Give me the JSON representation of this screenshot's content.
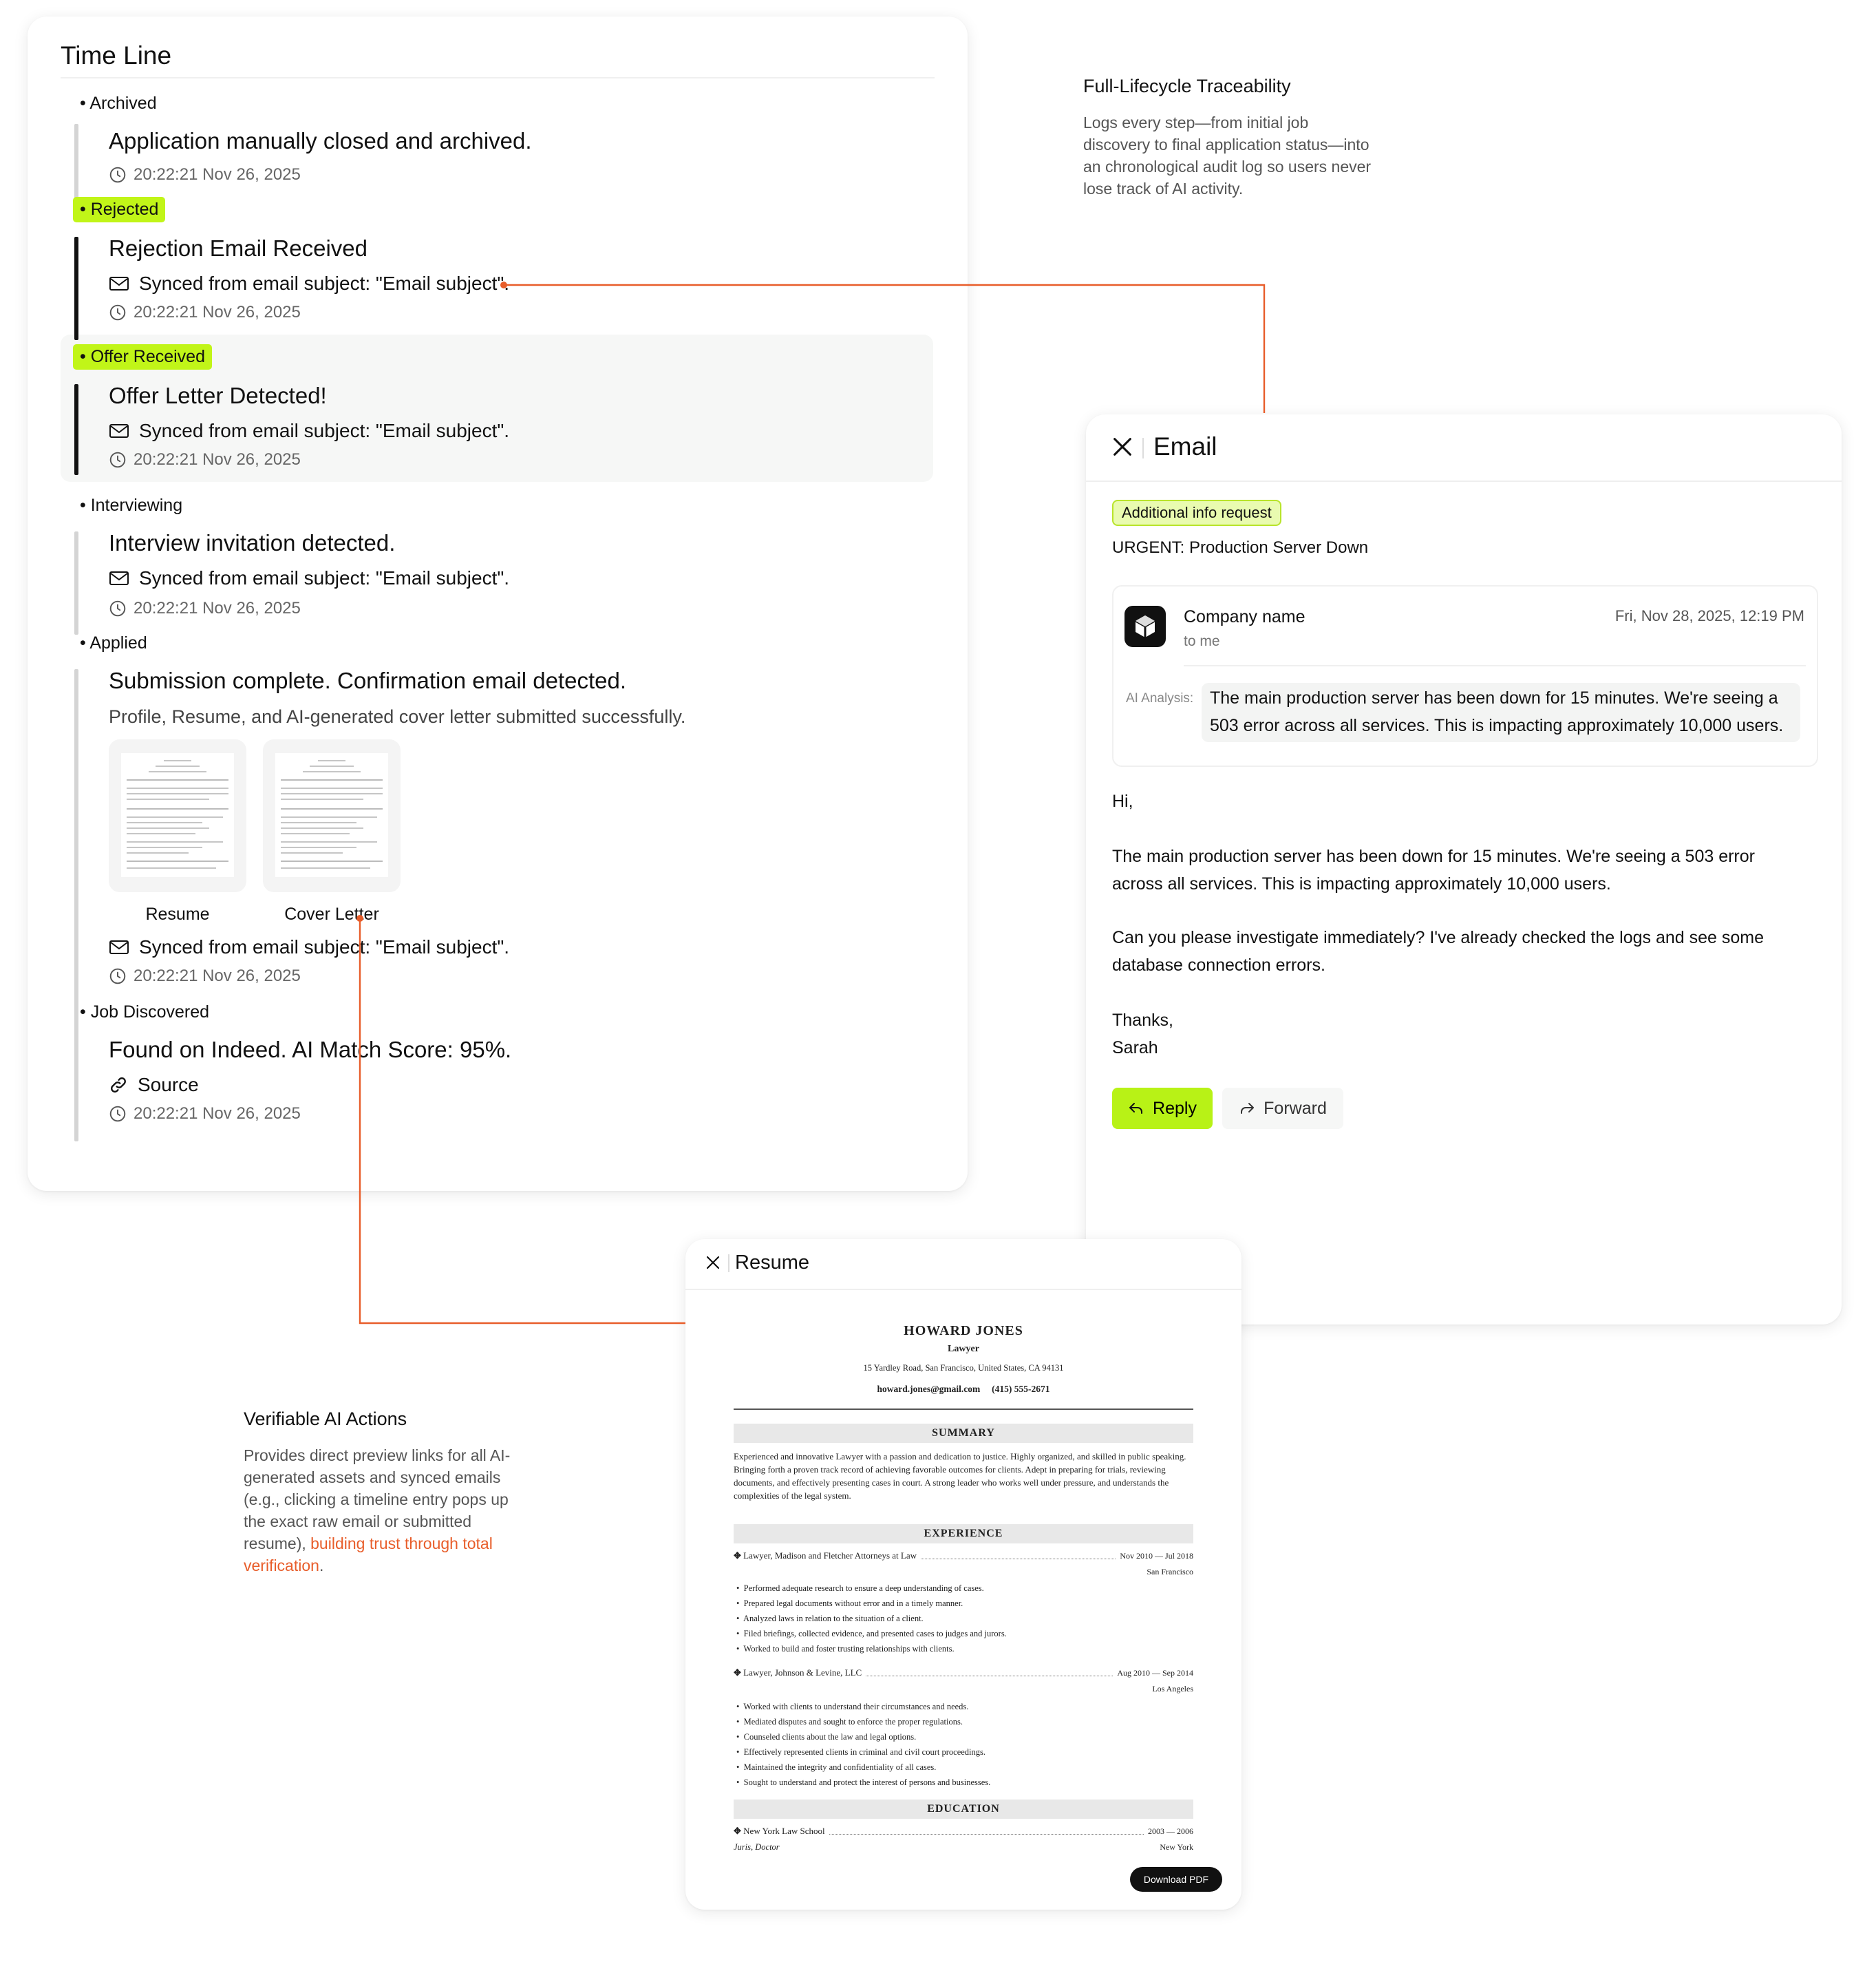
{
  "timeline": {
    "title": "Time Line",
    "entries": [
      {
        "status": "Archived",
        "title": "Application manually closed and archived.",
        "time": "20:22:21 Nov 26, 2025"
      },
      {
        "status": "Rejected",
        "title": "Rejection Email Received",
        "line": "Synced from email subject: \"Email subject\".",
        "time": "20:22:21 Nov 26, 2025"
      },
      {
        "status": "Offer Received",
        "title": "Offer Letter Detected!",
        "line": "Synced from email subject: \"Email subject\".",
        "time": "20:22:21 Nov 26, 2025"
      },
      {
        "status": "Interviewing",
        "title": "Interview invitation detected.",
        "line": "Synced from email subject: \"Email subject\".",
        "time": "20:22:21 Nov 26, 2025"
      },
      {
        "status": "Applied",
        "title": "Submission complete. Confirmation email detected.",
        "desc": "Profile, Resume, and AI-generated cover letter submitted successfully.",
        "attachments": [
          "Resume",
          "Cover Letter"
        ],
        "line": "Synced from email subject: \"Email subject\".",
        "time": "20:22:21 Nov 26, 2025"
      },
      {
        "status": "Job Discovered",
        "title": "Found on Indeed. AI Match Score: 95%.",
        "line": "Source",
        "time": "20:22:21 Nov 26, 2025"
      }
    ]
  },
  "annotations": {
    "traceability": {
      "title": "Full-Lifecycle Traceability",
      "lines": [
        "Logs every step—from initial job",
        "discovery to final application status—into",
        "an chronological audit log so users never",
        "lose track of AI activity."
      ]
    },
    "verifiable": {
      "title": "Verifiable AI Actions",
      "lines": [
        "Provides direct preview links for all AI-",
        "generated assets and synced emails",
        "(e.g., clicking a timeline entry pops up",
        "the exact raw email or submitted"
      ],
      "line5_plain": "resume), ",
      "line5_accent": "building trust through total",
      "line6_accent": "verification",
      "line6_tail": "."
    }
  },
  "email": {
    "title": "Email",
    "badge": "Additional info request",
    "subject": "URGENT: Production Server Down",
    "sender": "Company name",
    "recipient": "to me",
    "date": "Fri, Nov 28, 2025, 12:19 PM",
    "ai_label": "AI Analysis:",
    "ai_lines": [
      "The main production server has been down for 15 minutes. We're seeing a",
      "503 error across all services. This is impacting approximately 10,000 users."
    ],
    "body": [
      "Hi,",
      "The main production server has been down for 15 minutes. We're seeing a 503 error",
      "across all services. This is impacting approximately 10,000 users.",
      "Can you please investigate immediately? I've already checked the logs and see some",
      "database connection errors.",
      "Thanks,",
      "Sarah"
    ],
    "reply_label": "Reply",
    "forward_label": "Forward"
  },
  "resume": {
    "title": "Resume",
    "name": "HOWARD JONES",
    "role": "Lawyer",
    "address": "15 Yardley Road, San Francisco, United States, CA 94131",
    "email": "howard.jones@gmail.com",
    "phone": "(415) 555-2671",
    "summary_heading": "SUMMARY",
    "summary": "Experienced and innovative Lawyer with a passion and dedication to justice. Highly organized, and skilled in public speaking. Bringing forth a proven track record of achieving favorable outcomes for clients. Adept in preparing for trials, reviewing documents, and effectively presenting cases in court. A strong leader who works well under pressure, and understands the complexities of the legal system.",
    "experience_heading": "EXPERIENCE",
    "jobs": [
      {
        "company": "Lawyer, Madison and Fletcher Attorneys at Law",
        "dates": "Nov 2010 — Jul 2018",
        "location": "San Francisco",
        "bullets": [
          "Performed adequate research to ensure a deep understanding of cases.",
          "Prepared legal documents without error and in a timely manner.",
          "Analyzed laws in relation to the situation of a client.",
          "Filed briefings, collected evidence, and presented cases to judges and jurors.",
          "Worked to build and foster trusting relationships with clients."
        ]
      },
      {
        "company": "Lawyer, Johnson & Levine, LLC",
        "dates": "Aug 2010 — Sep 2014",
        "location": "Los Angeles",
        "bullets": [
          "Worked with clients to understand their circumstances and needs.",
          "Mediated disputes and sought to enforce the proper regulations.",
          "Counseled clients about the law and legal options.",
          "Effectively represented clients in criminal and civil court proceedings.",
          "Maintained the integrity and confidentiality of all cases.",
          "Sought to understand and protect the interest of persons and businesses."
        ]
      }
    ],
    "education_heading": "EDUCATION",
    "school": "New York Law School",
    "school_dates": "2003 — 2006",
    "degree": "Juris, Doctor",
    "school_location": "New York",
    "download_label": "Download PDF"
  },
  "colors": {
    "accent_lime": "#c1f518",
    "connector": "#e85d2a",
    "dark": "#111111"
  },
  "icons": [
    "clock-icon",
    "mail-icon",
    "link-icon",
    "close-icon",
    "reply-icon",
    "forward-icon"
  ]
}
